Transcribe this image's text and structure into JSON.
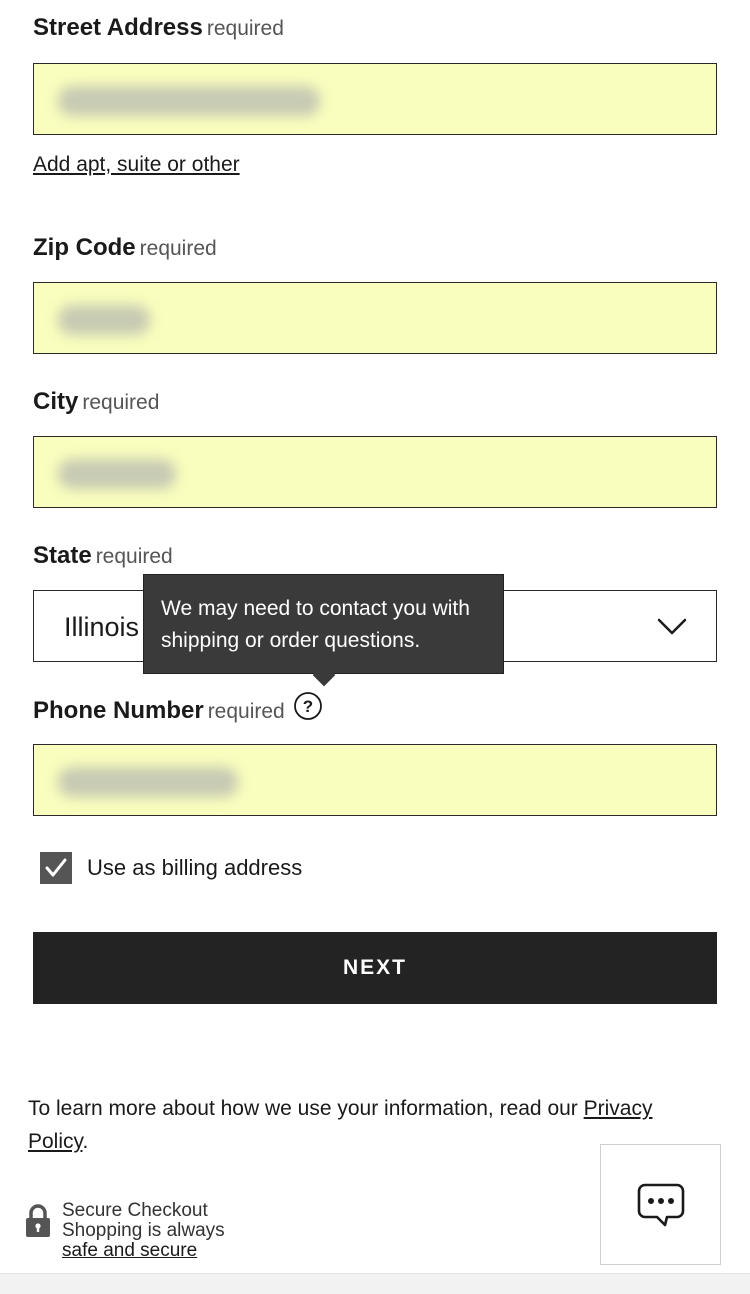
{
  "form": {
    "required_text": "required",
    "street": {
      "label": "Street Address",
      "add_apt_link": "Add apt, suite or other"
    },
    "zip": {
      "label": "Zip Code"
    },
    "city": {
      "label": "City"
    },
    "state": {
      "label": "State",
      "selected": "Illinois",
      "icon": "chevron-down-icon"
    },
    "phone": {
      "label": "Phone Number",
      "help_icon": "question-circle-icon",
      "tooltip": "We may need to contact you with shipping or order questions."
    },
    "billing": {
      "label": "Use as billing address",
      "checked": true
    },
    "next_button": "NEXT",
    "field_background": "#f9fdbd"
  },
  "footer": {
    "privacy_text": "To learn more about how we use your information, read our ",
    "privacy_link": "Privacy Policy",
    "privacy_end": ".",
    "secure_title": "Secure Checkout",
    "secure_line2": "Shopping is always",
    "secure_link": "safe and secure",
    "lock_icon": "lock-icon",
    "chat_icon": "chat-bubble-icon"
  }
}
